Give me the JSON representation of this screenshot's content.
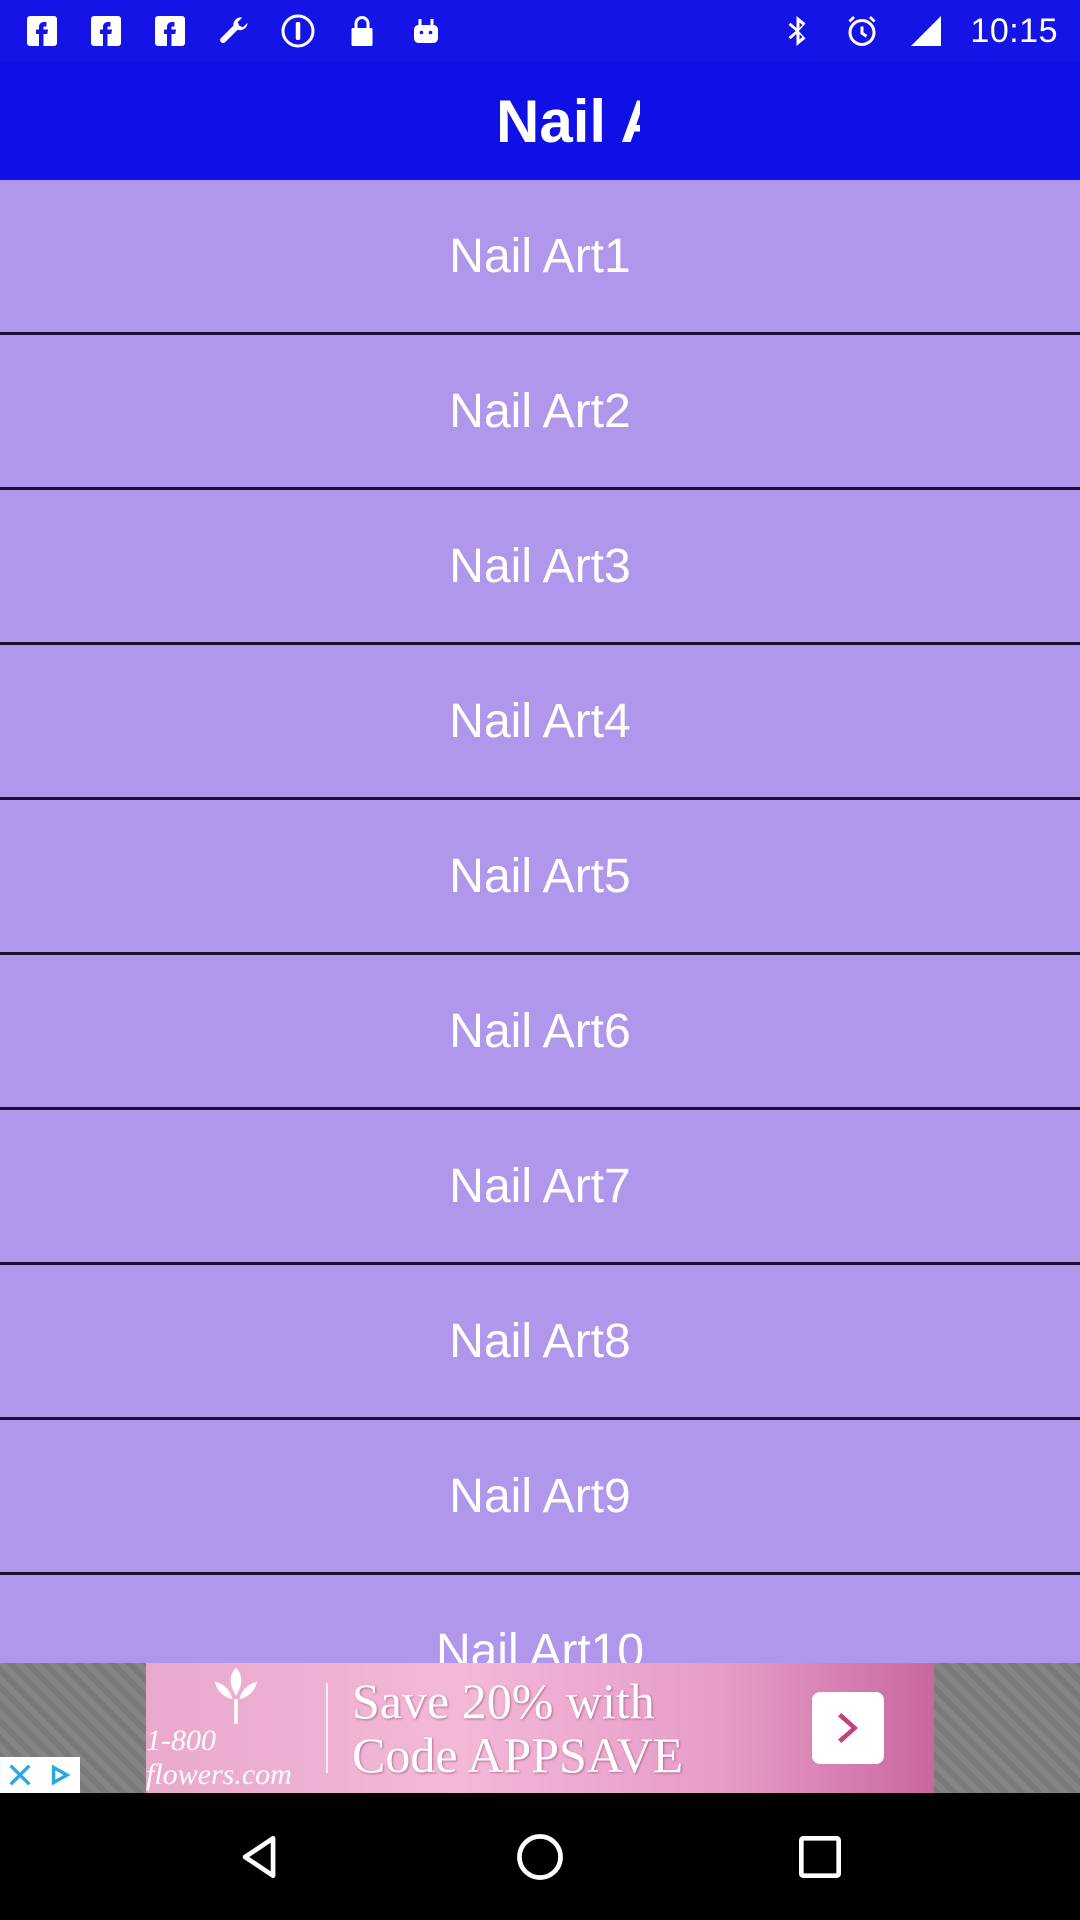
{
  "status_bar": {
    "time": "10:15",
    "left_icons": [
      "facebook-icon",
      "facebook-icon",
      "facebook-icon",
      "wrench-icon",
      "info-circle-icon",
      "lock-icon",
      "android-icon"
    ],
    "right_icons": [
      "bluetooth-icon",
      "alarm-icon",
      "signal-icon"
    ]
  },
  "app_bar": {
    "title": "Nail Art",
    "background": "#0f10e5"
  },
  "list": {
    "background": "#b197ec",
    "items": [
      {
        "label": "Nail Art1"
      },
      {
        "label": "Nail Art2"
      },
      {
        "label": "Nail Art3"
      },
      {
        "label": "Nail Art4"
      },
      {
        "label": "Nail Art5"
      },
      {
        "label": "Nail Art6"
      },
      {
        "label": "Nail Art7"
      },
      {
        "label": "Nail Art8"
      },
      {
        "label": "Nail Art9"
      },
      {
        "label": "Nail Art10"
      }
    ]
  },
  "ad": {
    "brand": "1-800 flowers.com",
    "headline_line1": "Save 20% with",
    "headline_line2": "Code APPSAVE"
  },
  "nav_bar": {
    "buttons": [
      "back-icon",
      "home-icon",
      "recents-icon"
    ]
  }
}
